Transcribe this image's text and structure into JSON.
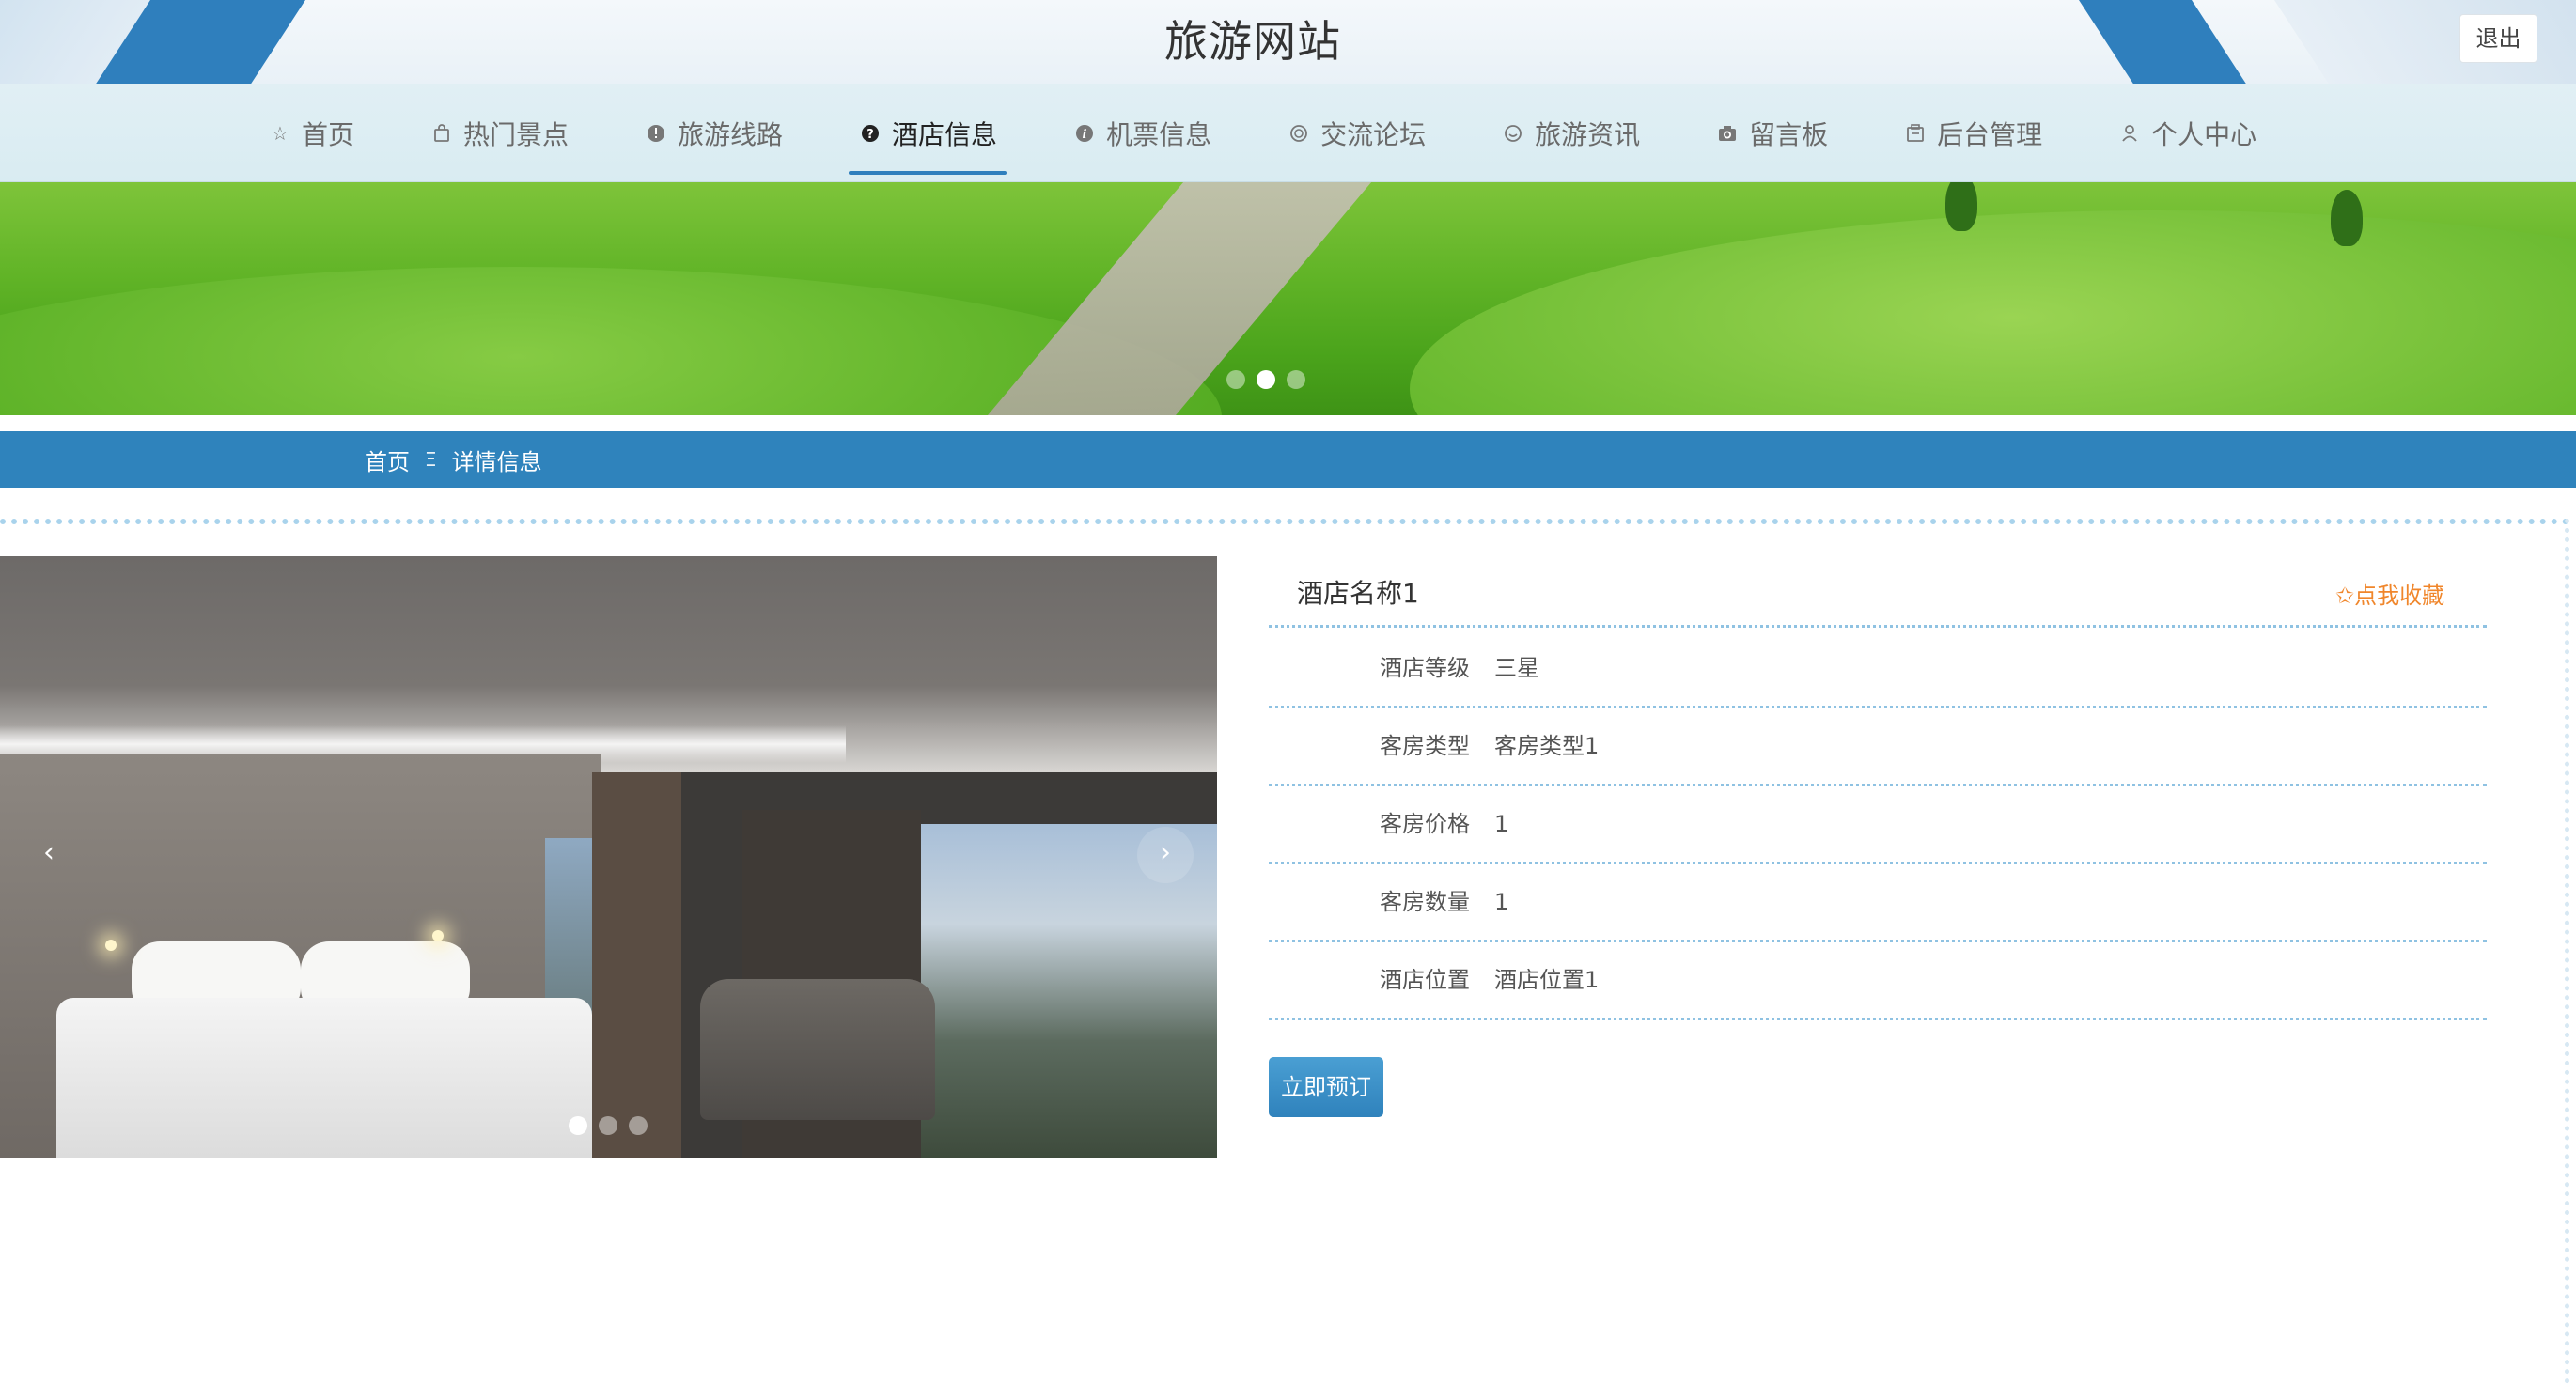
{
  "header": {
    "site_title": "旅游网站",
    "logout_label": "退出"
  },
  "nav": {
    "active_index": 3,
    "items": [
      {
        "label": "首页",
        "icon": "star-outline-icon"
      },
      {
        "label": "热门景点",
        "icon": "bag-icon"
      },
      {
        "label": "旅游线路",
        "icon": "info-circle-icon"
      },
      {
        "label": "酒店信息",
        "icon": "question-circle-icon"
      },
      {
        "label": "机票信息",
        "icon": "italic-info-icon"
      },
      {
        "label": "交流论坛",
        "icon": "circle-dot-icon"
      },
      {
        "label": "旅游资讯",
        "icon": "smile-icon"
      },
      {
        "label": "留言板",
        "icon": "camera-icon"
      },
      {
        "label": "后台管理",
        "icon": "building-icon"
      },
      {
        "label": "个人中心",
        "icon": "user-icon"
      }
    ]
  },
  "banner": {
    "slides": 3,
    "active_slide": 2
  },
  "breadcrumb": {
    "home": "首页",
    "separator": "Ξ",
    "current": "详情信息"
  },
  "gallery": {
    "slides": 3,
    "active_slide": 1,
    "prev_icon": "‹",
    "next_icon": "›"
  },
  "detail": {
    "name": "酒店名称1",
    "favorite_label": "✩点我收藏",
    "fields": [
      {
        "label": "酒店等级",
        "value": "三星"
      },
      {
        "label": "客房类型",
        "value": "客房类型1"
      },
      {
        "label": "客房价格",
        "value": "1"
      },
      {
        "label": "客房数量",
        "value": "1"
      },
      {
        "label": "酒店位置",
        "value": "酒店位置1"
      }
    ],
    "book_label": "立即预订"
  },
  "colors": {
    "accent": "#2f83bc",
    "favorite": "#f0862b",
    "dotted": "#8fc2e2"
  }
}
